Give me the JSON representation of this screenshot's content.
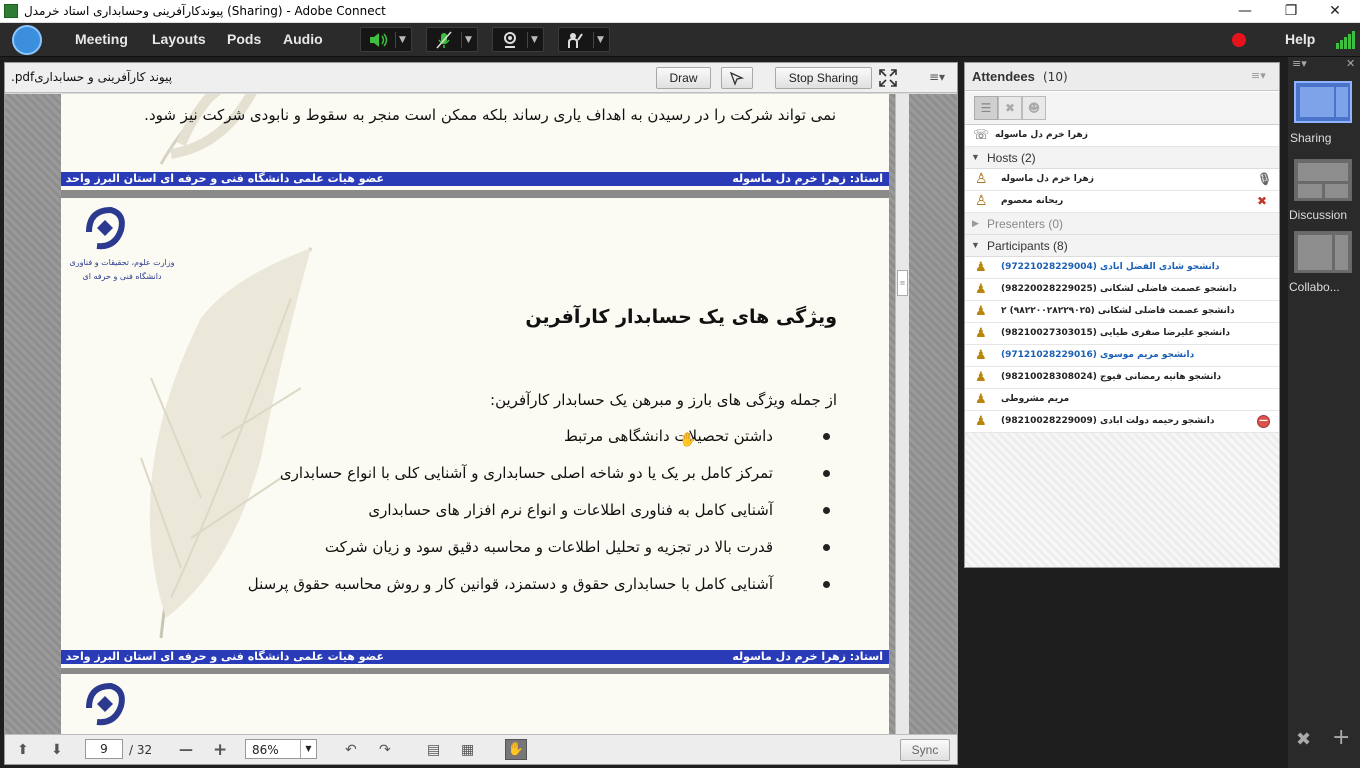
{
  "window": {
    "title": "پیوندکارآفرینی وحسابداری استاد خرمدل (Sharing) - Adobe Connect"
  },
  "menubar": {
    "items": [
      "Meeting",
      "Layouts",
      "Pods",
      "Audio"
    ],
    "help": "Help"
  },
  "share_pod": {
    "doc_name": ".pdfپیوند کارآفرینی و حسابداری",
    "draw_label": "Draw",
    "stop_label": "Stop Sharing",
    "slide_prev_text": "نمی تواند شرکت را در رسیدن به اهداف یاری رساند بلکه ممکن است منجر به سقوط و نابودی شرکت نیز شود.",
    "footer_left": "عضو هیات علمی دانشگاه فنی و حرفه ای استان البرز واحد دختران",
    "footer_right": "استاد: زهرا خرم دل ماسوله",
    "logo_line1": "وزارت علوم، تحقیقات و فناوری",
    "logo_line2": "دانشگاه فنی و حرفه ای",
    "slide_title": "ویژگی های یک حسابدار کارآفرین",
    "slide_intro": "از جمله ویژگی های بارز و مبرهن یک حسابدار کارآفرین:",
    "bullets": [
      "داشتن تحصیلات دانشگاهی مرتبط",
      "تمرکز کامل بر یک یا دو شاخه اصلی حسابداری و آشنایی کلی با انواع حسابداری",
      "آشنایی کامل به فناوری اطلاعات و انواع نرم افزار های حسابداری",
      "قدرت بالا در تجزیه و تحلیل اطلاعات و محاسبه دقیق سود و زیان شرکت",
      "آشنایی کامل با حسابداری حقوق و دستمزد، قوانین کار و روش محاسبه حقوق پرسنل"
    ],
    "page_current": "9",
    "page_total": "/ 32",
    "zoom": "86%",
    "sync_label": "Sync"
  },
  "attendees": {
    "title": "Attendees",
    "count": "(10)",
    "phone_user": "زهرا خرم دل ماسوله",
    "hosts_label": "Hosts (2)",
    "hosts": [
      "زهرا خرم دل ماسوله",
      "ریحانه معصوم"
    ],
    "presenters_label": "Presenters (0)",
    "participants_label": "Participants (8)",
    "participants": [
      "(97221028229004) دانشجو شادی الفضل ابادی",
      "(98220028229025) دانشجو عصمت فاضلی لشکانی",
      "دانشجو عصمت فاضلی لشکانی (۹۸۲۲۰۰۲۸۲۲۹۰۲۵) ۲",
      "(98210027303015) دانشجو علیرضا صفری طیایی",
      "(97121028229016) دانشجو مریم موسوی",
      "(98210028308024) دانشجو هانیه رمضانی فیوج",
      "مریم مشروطی",
      "(98210028229009) دانشجو رحیمه دولت ابادی"
    ],
    "participant_colors": [
      "#1a5fb4",
      "#222222",
      "#222222",
      "#222222",
      "#1a5fb4",
      "#222222",
      "#222222",
      "#222222"
    ]
  },
  "layouts_rail": {
    "items": [
      "Sharing",
      "Discussion",
      "Collabo..."
    ]
  },
  "colors": {
    "accent": "#2a3bb8",
    "record": "#e8141c",
    "mic_on": "#3fbf3f"
  }
}
